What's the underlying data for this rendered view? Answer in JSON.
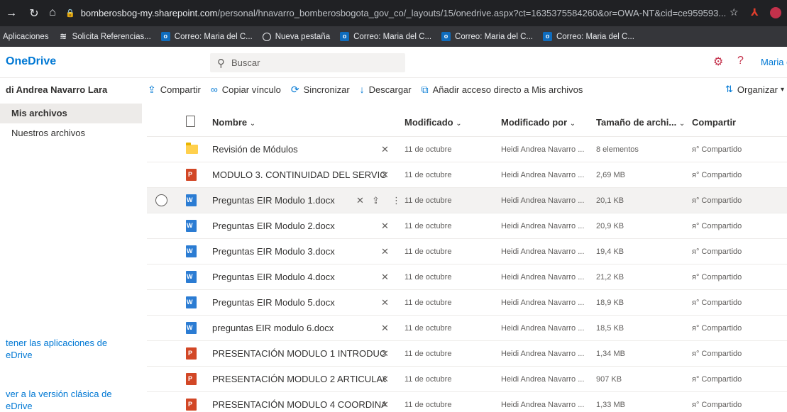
{
  "browser": {
    "url_host": "bomberosbog-my.sharepoint.com",
    "url_path": "/personal/hnavarro_bomberosbogota_gov_co/_layouts/15/onedrive.aspx?ct=1635375584260&or=OWA-NT&cid=ce959593..."
  },
  "bookmarks": [
    {
      "label": "Aplicaciones",
      "icon": "apps-grid-icon"
    },
    {
      "label": "Solicita Referencias...",
      "icon": "references-icon"
    },
    {
      "label": "Correo: Maria del C...",
      "icon": "outlook-icon"
    },
    {
      "label": "Nueva pestaña",
      "icon": "globe-icon"
    },
    {
      "label": "Correo: Maria del C...",
      "icon": "outlook-icon"
    },
    {
      "label": "Correo: Maria del C...",
      "icon": "outlook-icon"
    },
    {
      "label": "Correo: Maria del C...",
      "icon": "outlook-icon"
    }
  ],
  "header": {
    "app_name": "OneDrive",
    "search_placeholder": "Buscar",
    "user_name": "Maria del"
  },
  "leftnav": {
    "owner": "di Andrea Navarro Lara",
    "items": [
      {
        "label": "Mis archivos",
        "active": true
      },
      {
        "label": "Nuestros archivos",
        "active": false
      }
    ],
    "bottom_links": [
      "tener las aplicaciones de eDrive",
      "ver a la versión clásica de eDrive"
    ]
  },
  "commands": [
    {
      "label": "Compartir",
      "icon": "share-icon"
    },
    {
      "label": "Copiar vínculo",
      "icon": "link-icon"
    },
    {
      "label": "Sincronizar",
      "icon": "sync-icon"
    },
    {
      "label": "Descargar",
      "icon": "download-icon"
    },
    {
      "label": "Añadir acceso directo a Mis archivos",
      "icon": "shortcut-icon"
    }
  ],
  "organizar_label": "Organizar",
  "columns": {
    "name": "Nombre",
    "modified": "Modificado",
    "modified_by": "Modificado por",
    "size": "Tamaño de archi...",
    "sharing": "Compartir"
  },
  "files": [
    {
      "name": "Revisión de Módulos",
      "type": "folder",
      "modified": "11 de octubre",
      "modified_by": "Heidi Andrea Navarro ...",
      "size": "8 elementos",
      "sharing": "Compartido"
    },
    {
      "name": "MODULO 3. CONTINUIDAD DEL SERVICI...",
      "type": "ppt",
      "modified": "11 de octubre",
      "modified_by": "Heidi Andrea Navarro ...",
      "size": "2,69 MB",
      "sharing": "Compartido"
    },
    {
      "name": "Preguntas EIR Modulo 1.docx",
      "type": "word",
      "modified": "11 de octubre",
      "modified_by": "Heidi Andrea Navarro ...",
      "size": "20,1 KB",
      "sharing": "Compartido",
      "selected": true
    },
    {
      "name": "Preguntas EIR Modulo 2.docx",
      "type": "word",
      "modified": "11 de octubre",
      "modified_by": "Heidi Andrea Navarro ...",
      "size": "20,9 KB",
      "sharing": "Compartido"
    },
    {
      "name": "Preguntas EIR Modulo 3.docx",
      "type": "word",
      "modified": "11 de octubre",
      "modified_by": "Heidi Andrea Navarro ...",
      "size": "19,4 KB",
      "sharing": "Compartido"
    },
    {
      "name": "Preguntas EIR Modulo 4.docx",
      "type": "word",
      "modified": "11 de octubre",
      "modified_by": "Heidi Andrea Navarro ...",
      "size": "21,2 KB",
      "sharing": "Compartido"
    },
    {
      "name": "Preguntas EIR Modulo 5.docx",
      "type": "word",
      "modified": "11 de octubre",
      "modified_by": "Heidi Andrea Navarro ...",
      "size": "18,9 KB",
      "sharing": "Compartido"
    },
    {
      "name": "preguntas EIR modulo 6.docx",
      "type": "word",
      "modified": "11 de octubre",
      "modified_by": "Heidi Andrea Navarro ...",
      "size": "18,5 KB",
      "sharing": "Compartido"
    },
    {
      "name": "PRESENTACIÓN MODULO 1 INTRODUCCI...",
      "type": "ppt",
      "modified": "11 de octubre",
      "modified_by": "Heidi Andrea Navarro ...",
      "size": "1,34 MB",
      "sharing": "Compartido"
    },
    {
      "name": "PRESENTACIÓN MODULO 2 ARTICULACI...",
      "type": "ppt",
      "modified": "11 de octubre",
      "modified_by": "Heidi Andrea Navarro ...",
      "size": "907 KB",
      "sharing": "Compartido"
    },
    {
      "name": "PRESENTACIÓN MODULO 4 COORDINAC...",
      "type": "ppt",
      "modified": "11 de octubre",
      "modified_by": "Heidi Andrea Navarro ...",
      "size": "1,33 MB",
      "sharing": "Compartido"
    }
  ]
}
